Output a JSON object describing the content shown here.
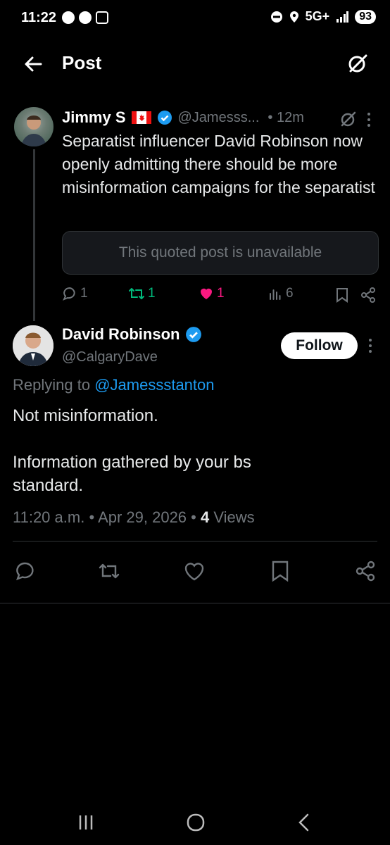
{
  "status": {
    "time": "11:22",
    "network": "5G+",
    "battery": "93"
  },
  "header": {
    "title": "Post"
  },
  "parent": {
    "name": "Jimmy S",
    "handle": "@Jamesss...",
    "time": "• 12m",
    "text": "Separatist influencer David Robinson now openly admitting there should be more misinformation campaigns for the separatist",
    "quote_unavailable": "This quoted post is unavailable",
    "replies": "1",
    "reposts": "1",
    "likes": "1",
    "views": "6",
    "colors": {
      "like": "#f91880",
      "repost": "#00ba7c",
      "verified": "#1d9bf0"
    }
  },
  "reply": {
    "name": "David Robinson",
    "handle": "@CalgaryDave",
    "follow_label": "Follow",
    "replying_to_prefix": "Replying to",
    "replying_to_handle": "@Jamessstanton",
    "text_line1": "Not misinformation.",
    "text_line2": "Information gathered by your bs standard.",
    "time": "11:20 a.m.",
    "date": "Apr 29, 2026",
    "views_count": "4",
    "views_label": "Views"
  }
}
